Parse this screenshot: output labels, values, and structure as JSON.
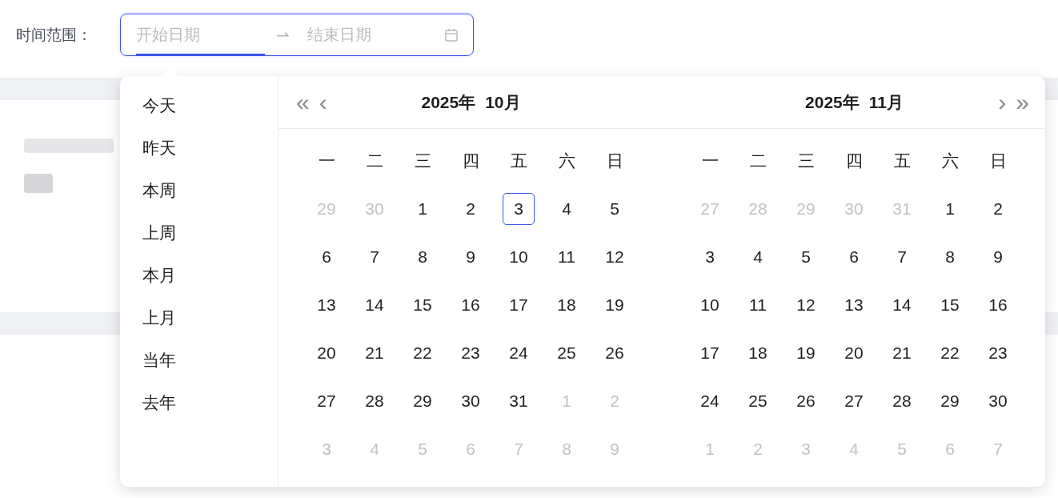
{
  "filter": {
    "label": "时间范围：",
    "separator": "⇀",
    "inputs": [
      {
        "placeholder": "开始日期",
        "active": true
      },
      {
        "placeholder": "结束日期",
        "active": false
      }
    ]
  },
  "presets": [
    "今天",
    "昨天",
    "本周",
    "上周",
    "本月",
    "上月",
    "当年",
    "去年"
  ],
  "nav": {
    "prev_year": "«",
    "prev_month": "‹",
    "next_month": "›",
    "next_year": "»"
  },
  "panels": [
    {
      "year": "2025年",
      "month": "10月",
      "weekdays": [
        "一",
        "二",
        "三",
        "四",
        "五",
        "六",
        "日"
      ],
      "weeks": [
        [
          {
            "d": "29",
            "in_month": false,
            "today": false
          },
          {
            "d": "30",
            "in_month": false,
            "today": false
          },
          {
            "d": "1",
            "in_month": true,
            "today": false
          },
          {
            "d": "2",
            "in_month": true,
            "today": false
          },
          {
            "d": "3",
            "in_month": true,
            "today": true
          },
          {
            "d": "4",
            "in_month": true,
            "today": false
          },
          {
            "d": "5",
            "in_month": true,
            "today": false
          }
        ],
        [
          {
            "d": "6",
            "in_month": true,
            "today": false
          },
          {
            "d": "7",
            "in_month": true,
            "today": false
          },
          {
            "d": "8",
            "in_month": true,
            "today": false
          },
          {
            "d": "9",
            "in_month": true,
            "today": false
          },
          {
            "d": "10",
            "in_month": true,
            "today": false
          },
          {
            "d": "11",
            "in_month": true,
            "today": false
          },
          {
            "d": "12",
            "in_month": true,
            "today": false
          }
        ],
        [
          {
            "d": "13",
            "in_month": true,
            "today": false
          },
          {
            "d": "14",
            "in_month": true,
            "today": false
          },
          {
            "d": "15",
            "in_month": true,
            "today": false
          },
          {
            "d": "16",
            "in_month": true,
            "today": false
          },
          {
            "d": "17",
            "in_month": true,
            "today": false
          },
          {
            "d": "18",
            "in_month": true,
            "today": false
          },
          {
            "d": "19",
            "in_month": true,
            "today": false
          }
        ],
        [
          {
            "d": "20",
            "in_month": true,
            "today": false
          },
          {
            "d": "21",
            "in_month": true,
            "today": false
          },
          {
            "d": "22",
            "in_month": true,
            "today": false
          },
          {
            "d": "23",
            "in_month": true,
            "today": false
          },
          {
            "d": "24",
            "in_month": true,
            "today": false
          },
          {
            "d": "25",
            "in_month": true,
            "today": false
          },
          {
            "d": "26",
            "in_month": true,
            "today": false
          }
        ],
        [
          {
            "d": "27",
            "in_month": true,
            "today": false
          },
          {
            "d": "28",
            "in_month": true,
            "today": false
          },
          {
            "d": "29",
            "in_month": true,
            "today": false
          },
          {
            "d": "30",
            "in_month": true,
            "today": false
          },
          {
            "d": "31",
            "in_month": true,
            "today": false
          },
          {
            "d": "1",
            "in_month": false,
            "today": false
          },
          {
            "d": "2",
            "in_month": false,
            "today": false
          }
        ],
        [
          {
            "d": "3",
            "in_month": false,
            "today": false
          },
          {
            "d": "4",
            "in_month": false,
            "today": false
          },
          {
            "d": "5",
            "in_month": false,
            "today": false
          },
          {
            "d": "6",
            "in_month": false,
            "today": false
          },
          {
            "d": "7",
            "in_month": false,
            "today": false
          },
          {
            "d": "8",
            "in_month": false,
            "today": false
          },
          {
            "d": "9",
            "in_month": false,
            "today": false
          }
        ]
      ]
    },
    {
      "year": "2025年",
      "month": "11月",
      "weekdays": [
        "一",
        "二",
        "三",
        "四",
        "五",
        "六",
        "日"
      ],
      "weeks": [
        [
          {
            "d": "27",
            "in_month": false,
            "today": false
          },
          {
            "d": "28",
            "in_month": false,
            "today": false
          },
          {
            "d": "29",
            "in_month": false,
            "today": false
          },
          {
            "d": "30",
            "in_month": false,
            "today": false
          },
          {
            "d": "31",
            "in_month": false,
            "today": false
          },
          {
            "d": "1",
            "in_month": true,
            "today": false
          },
          {
            "d": "2",
            "in_month": true,
            "today": false
          }
        ],
        [
          {
            "d": "3",
            "in_month": true,
            "today": false
          },
          {
            "d": "4",
            "in_month": true,
            "today": false
          },
          {
            "d": "5",
            "in_month": true,
            "today": false
          },
          {
            "d": "6",
            "in_month": true,
            "today": false
          },
          {
            "d": "7",
            "in_month": true,
            "today": false
          },
          {
            "d": "8",
            "in_month": true,
            "today": false
          },
          {
            "d": "9",
            "in_month": true,
            "today": false
          }
        ],
        [
          {
            "d": "10",
            "in_month": true,
            "today": false
          },
          {
            "d": "11",
            "in_month": true,
            "today": false
          },
          {
            "d": "12",
            "in_month": true,
            "today": false
          },
          {
            "d": "13",
            "in_month": true,
            "today": false
          },
          {
            "d": "14",
            "in_month": true,
            "today": false
          },
          {
            "d": "15",
            "in_month": true,
            "today": false
          },
          {
            "d": "16",
            "in_month": true,
            "today": false
          }
        ],
        [
          {
            "d": "17",
            "in_month": true,
            "today": false
          },
          {
            "d": "18",
            "in_month": true,
            "today": false
          },
          {
            "d": "19",
            "in_month": true,
            "today": false
          },
          {
            "d": "20",
            "in_month": true,
            "today": false
          },
          {
            "d": "21",
            "in_month": true,
            "today": false
          },
          {
            "d": "22",
            "in_month": true,
            "today": false
          },
          {
            "d": "23",
            "in_month": true,
            "today": false
          }
        ],
        [
          {
            "d": "24",
            "in_month": true,
            "today": false
          },
          {
            "d": "25",
            "in_month": true,
            "today": false
          },
          {
            "d": "26",
            "in_month": true,
            "today": false
          },
          {
            "d": "27",
            "in_month": true,
            "today": false
          },
          {
            "d": "28",
            "in_month": true,
            "today": false
          },
          {
            "d": "29",
            "in_month": true,
            "today": false
          },
          {
            "d": "30",
            "in_month": true,
            "today": false
          }
        ],
        [
          {
            "d": "1",
            "in_month": false,
            "today": false
          },
          {
            "d": "2",
            "in_month": false,
            "today": false
          },
          {
            "d": "3",
            "in_month": false,
            "today": false
          },
          {
            "d": "4",
            "in_month": false,
            "today": false
          },
          {
            "d": "5",
            "in_month": false,
            "today": false
          },
          {
            "d": "6",
            "in_month": false,
            "today": false
          },
          {
            "d": "7",
            "in_month": false,
            "today": false
          }
        ]
      ]
    }
  ]
}
